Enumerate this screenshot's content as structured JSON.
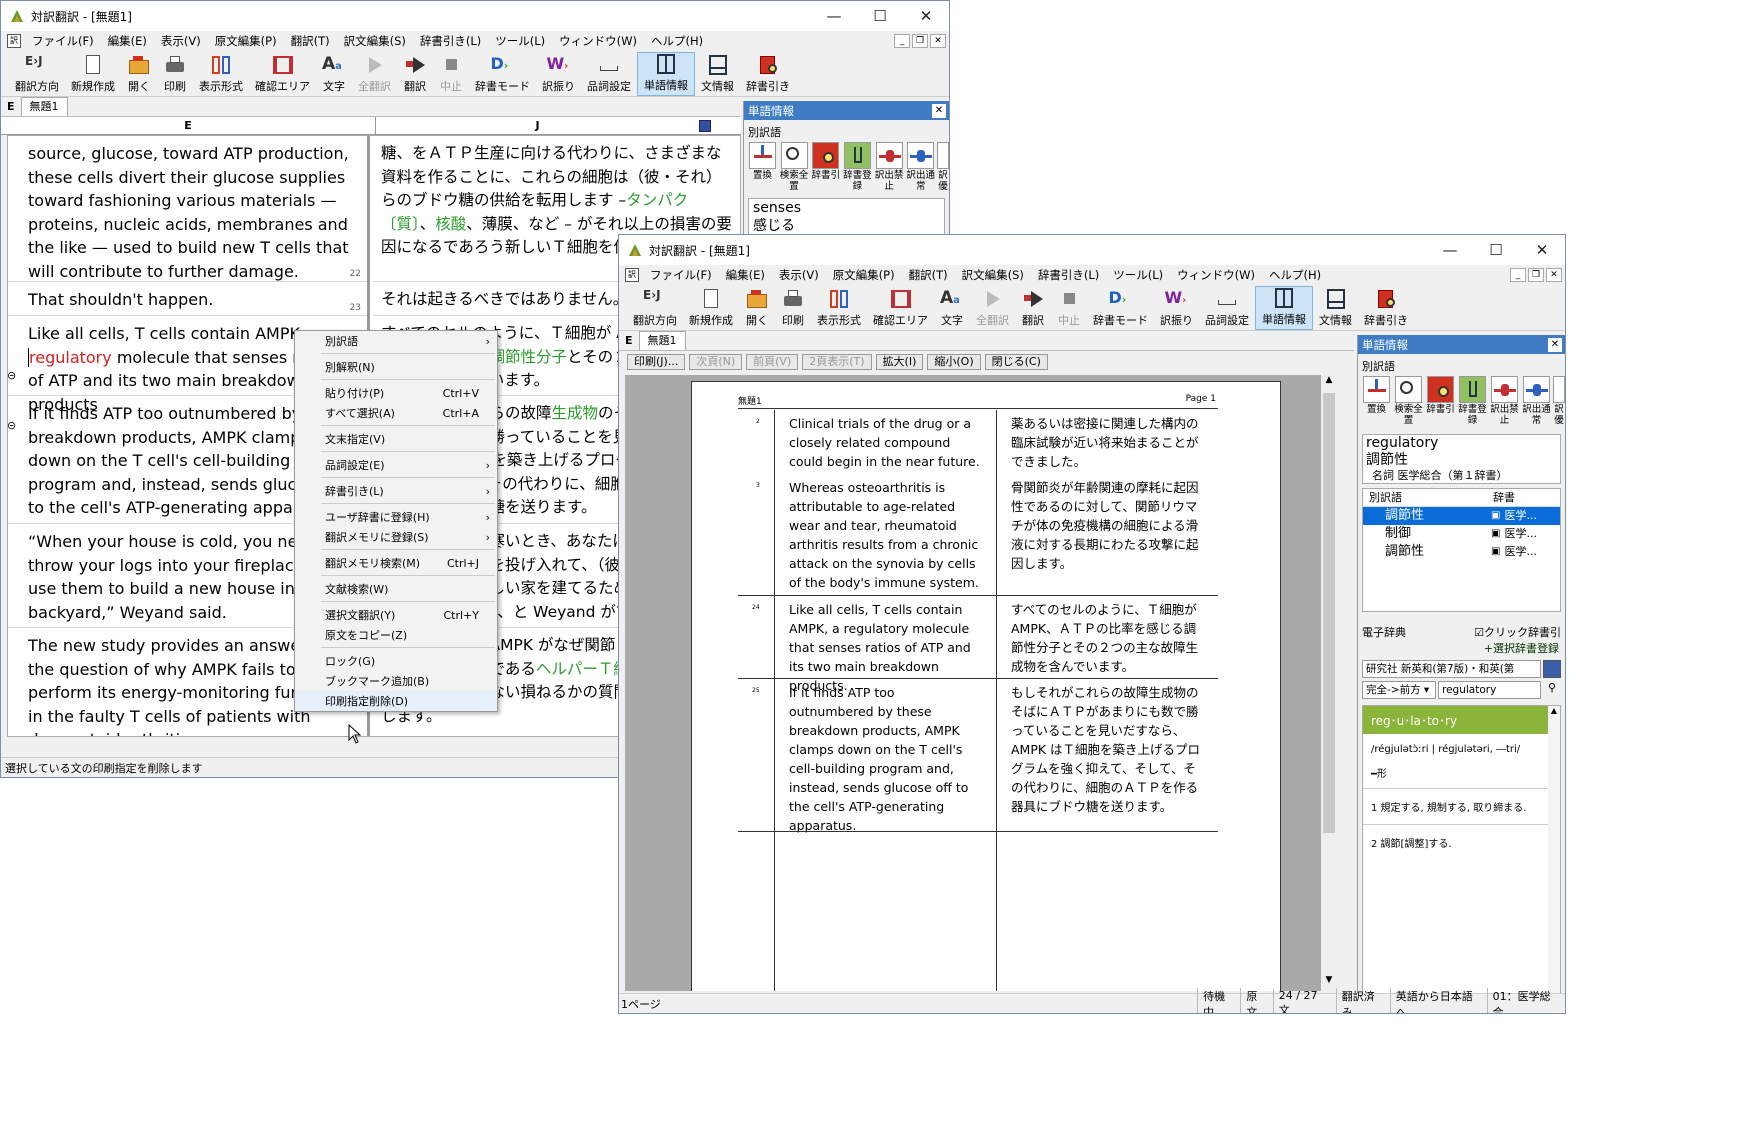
{
  "win1": {
    "title": "対訳翻訳 - [無題1]",
    "menu": [
      "ファイル(F)",
      "編集(E)",
      "表示(V)",
      "原文編集(P)",
      "翻訳(T)",
      "訳文編集(S)",
      "辞書引き(L)",
      "ツール(L)",
      "ウィンドウ(W)",
      "ヘルプ(H)"
    ],
    "toolbar": [
      "翻訳方向",
      "新規作成",
      "開く",
      "印刷",
      "表示形式",
      "確認エリア",
      "文字",
      "全翻訳",
      "翻訳",
      "中止",
      "辞書モード",
      "訳振り",
      "品詞設定",
      "単語情報",
      "文情報",
      "辞書引き"
    ],
    "tab": "無題1",
    "col_e": "E",
    "col_j": "J",
    "segments": [
      {
        "en": "source, glucose, toward ATP production, these cells divert their glucose supplies toward fashioning various materials — proteins, nucleic acids, membranes and the like — used to build new T cells that will contribute to further damage.",
        "ja_pre": "糖、をＡＴＰ生産に向ける代わりに、さまざまな資料を作ることに、これらの細胞は（彼・それ）らのブドウ糖の供給を転用します –",
        "ja_green1": "タンパク〔質〕",
        "ja_mid": "、",
        "ja_green2": "核酸",
        "ja_post": "、薄膜、など – がそれ以上の損害の要因になるであろう新しいＴ細胞を作ったもの",
        "num": "22"
      },
      {
        "en": "That shouldn't happen.",
        "ja": "それは起きるべきではありません。",
        "num": "23"
      },
      {
        "en_pre": "Like all cells, T cells contain AMPK, a ",
        "en_red": "regulatory",
        "en_post": " molecule that senses ratios of ATP and its two main breakdown products",
        "ja_pre": "すべてのセルのように、Ｔ細胞が AMPK、ＡＴＰの比率を感じる",
        "ja_green": "調節性分子",
        "ja_post": "とその２つの主な故障生成物を含んでいます。"
      },
      {
        "en": "If it finds ATP too outnumbered by these breakdown products, AMPK clamps down on the T cell's cell-building program and, instead, sends glucose off to the cell's ATP-generating apparatus.",
        "ja_pre": "もしそれがこれらの故障",
        "ja_green": "生成物",
        "ja_post": "のそばにＡＴＰがあまりにも数で勝っていることを見いだすなら、AMPK はＴ細胞を築き上げるプログラムを強く抑えて、そして、その代わりに、細胞のＡＴＰを作る器具にブドウ糖を送ります。"
      },
      {
        "en": "“When your house is cold, you need to throw your logs into your fireplace, not use them to build a new house in your backyard,” Weyand said.",
        "ja": "「あなたの家が寒いとき、あなたはあなたの暖炉にあなたの丸太を投げ入れて、（彼・それ）らをあなたの裏庭に新しい家を建てるために使わないでいる必要がある」、と Weyand が言いました。"
      },
      {
        "en": "The new study provides an answer to the question of why AMPK fails to perform its energy-monitoring function in the faulty T cells of patients with rheumatoid arthritis.",
        "ja_pre": "新しい研究は、AMPK がなぜ関節リウマチ患者のヘルパーＴ細胞である",
        "ja_green": "ヘルパーＴ細胞",
        "ja_post": "でエネルギー監視機能を行ない損ねるかの質問に答えを提供します。"
      }
    ],
    "word_panel": {
      "title": "単語情報",
      "section": "別訳語",
      "icons": [
        "置換",
        "検索全置",
        "辞書引",
        "辞書登録",
        "訳出禁止",
        "訳出通常",
        "訳優"
      ],
      "words": [
        "senses",
        "感じる"
      ]
    },
    "status": "選択している文の印刷指定を削除します",
    "status_right": "待"
  },
  "context_menu": [
    {
      "label": "別訳語",
      "arrow": true
    },
    {
      "sep": true
    },
    {
      "label": "別解釈(N)"
    },
    {
      "sep": true
    },
    {
      "label": "貼り付け(P)",
      "shortcut": "Ctrl+V"
    },
    {
      "label": "すべて選択(A)",
      "shortcut": "Ctrl+A"
    },
    {
      "sep": true
    },
    {
      "label": "文末指定(V)"
    },
    {
      "sep": true
    },
    {
      "label": "品詞設定(E)",
      "arrow": true
    },
    {
      "sep": true
    },
    {
      "label": "辞書引き(L)",
      "arrow": true
    },
    {
      "sep": true
    },
    {
      "label": "ユーザ辞書に登録(H)",
      "arrow": true
    },
    {
      "label": "翻訳メモリに登録(S)",
      "arrow": true
    },
    {
      "sep": true
    },
    {
      "label": "翻訳メモリ検索(M)",
      "shortcut": "Ctrl+J"
    },
    {
      "sep": true
    },
    {
      "label": "文献検索(W)"
    },
    {
      "sep": true
    },
    {
      "label": "選択文翻訳(Y)",
      "shortcut": "Ctrl+Y"
    },
    {
      "label": "原文をコピー(Z)"
    },
    {
      "sep": true
    },
    {
      "label": "ロック(G)"
    },
    {
      "label": "ブックマーク追加(B)"
    },
    {
      "label": "印刷指定削除(D)",
      "hl": true
    }
  ],
  "win2": {
    "title": "対訳翻訳 - [無題1]",
    "tab": "無題1",
    "print_buttons": [
      {
        "label": "印刷(J)...",
        "dis": false
      },
      {
        "label": "次頁(N)",
        "dis": true
      },
      {
        "label": "前頁(V)",
        "dis": true
      },
      {
        "label": "2頁表示(T)",
        "dis": true
      },
      {
        "label": "拡大(I)",
        "dis": false
      },
      {
        "label": "縮小(O)",
        "dis": false
      },
      {
        "label": "閉じる(C)",
        "dis": false
      }
    ],
    "page_header_left": "無題1",
    "page_header_right": "Page  1",
    "rows": [
      {
        "num": "2",
        "en": "Clinical trials of the drug or a closely related compound could begin in the near future.",
        "ja": "薬あるいは密接に関連した構内の臨床試験が近い将来始まることができました。"
      },
      {
        "num": "3",
        "en": "Whereas osteoarthritis is attributable to age-related wear and tear, rheumatoid arthritis results from a chronic attack on the synovia by cells of the body's immune system.",
        "ja": "骨関節炎が年齢関連の摩耗に起因性であるのに対して、関節リウマチが体の免疫機構の細胞による滑液に対する長期にわたる攻撃に起因します。"
      },
      {
        "num": "24",
        "en": "Like all cells, T cells contain AMPK, a regulatory molecule that senses ratios of ATP and its two main breakdown products.",
        "ja": "すべてのセルのように、Ｔ細胞が AMPK、ＡＴＰの比率を感じる調節性分子とその２つの主な故障生成物を含んでいます。"
      },
      {
        "num": "25",
        "en": "If it finds ATP too outnumbered by these breakdown products, AMPK clamps down on the T cell's cell-building program and, instead, sends glucose off to the cell's ATP-generating apparatus.",
        "ja": "もしそれがこれらの故障生成物のそばにＡＴＰがあまりにも数で勝っていることを見いだすなら、AMPK はＴ細胞を築き上げるプログラムを強く抑えて、そして、その代わりに、細胞のＡＴＰを作る器具にブドウ糖を送ります。"
      }
    ],
    "word_panel": {
      "title": "単語情報",
      "section": "別訳語",
      "word": "regulatory",
      "reading": "調節性",
      "pos": "名詞  医学総合（第１辞書）",
      "head_alt": "別訳語",
      "head_dict": "辞書",
      "alts": [
        {
          "w": "調節性",
          "d": "医学..."
        },
        {
          "w": "制御",
          "d": "医学..."
        },
        {
          "w": "調節性",
          "d": "医学..."
        }
      ],
      "edict": "電子辞典",
      "click_lookup": "クリック辞書引",
      "sel_register": "+選択辞書登録",
      "dict_select": "研究社 新英和(第7版)・和英(第",
      "mode": "完全->前方",
      "query": "regulatory",
      "entry_head": "reg･u･la･to･ry",
      "pron": "/régjulətɔ̀ːri | régjulətəri, ―tri/",
      "gram": "━形",
      "sense1": "1 規定する, 規制する, 取り締まる.",
      "sense2": "2 調節[調整]する."
    },
    "status": [
      "1ページ",
      "待機中",
      "原文",
      "24 / 27 文",
      "翻訳済み",
      "英語から日本語へ",
      "01：医学総合"
    ]
  }
}
